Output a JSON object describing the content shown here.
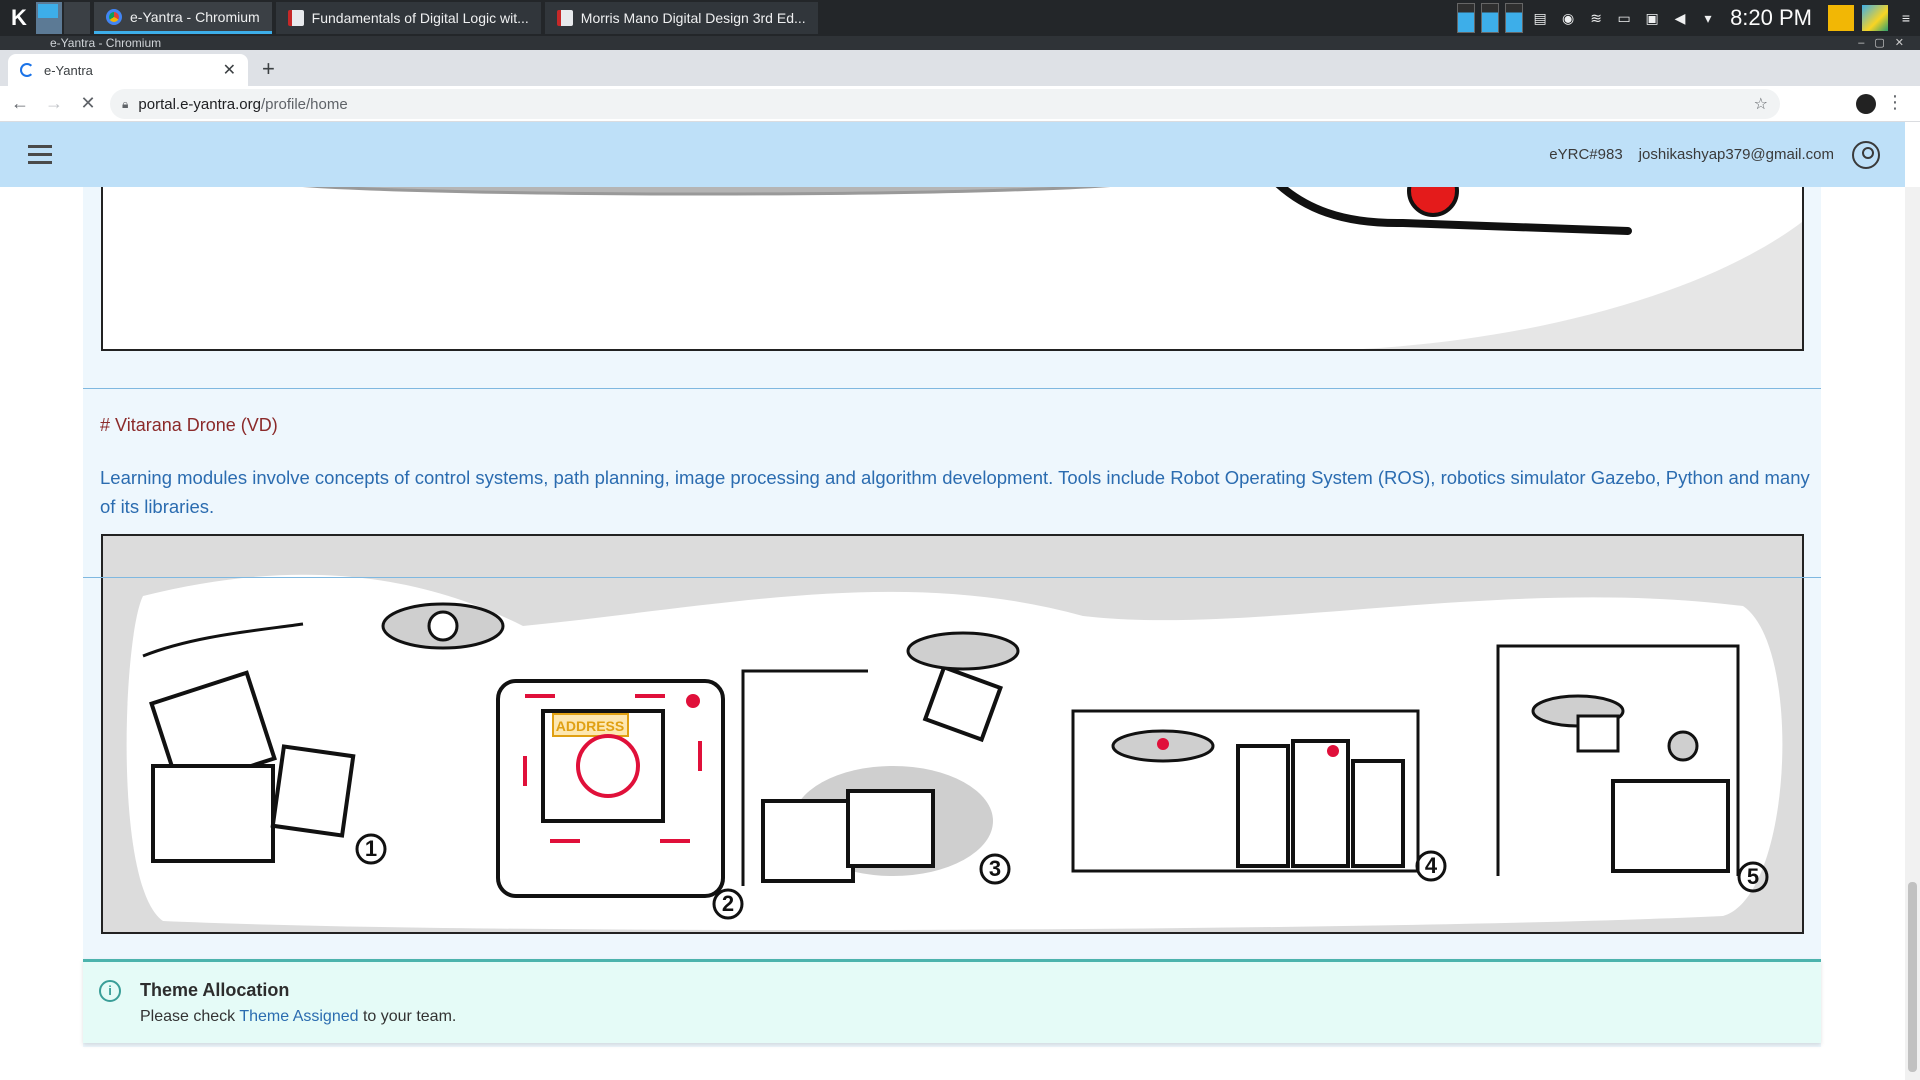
{
  "taskbar": {
    "tasks": [
      {
        "label": "e-Yantra - Chromium"
      },
      {
        "label": "Fundamentals of Digital Logic wit..."
      },
      {
        "label": "Morris Mano Digital Design 3rd Ed..."
      }
    ],
    "clock": "8:20 PM"
  },
  "window": {
    "title": "e-Yantra - Chromium"
  },
  "browser": {
    "tab_title": "e-Yantra",
    "url_host": "portal.e-yantra.org",
    "url_path": "/profile/home"
  },
  "header": {
    "team_id": "eYRC#983",
    "email": "joshikashyap379@gmail.com"
  },
  "theme_section": {
    "title": "# Vitarana Drone (VD)",
    "description": "Learning modules involve concepts of control systems, path planning, image processing and algorithm development. Tools include Robot Operating System (ROS), robotics simulator Gazebo, Python and many of its libraries.",
    "illustration_labels": [
      "ADDRESS",
      "1",
      "2",
      "3",
      "4",
      "5"
    ]
  },
  "alert": {
    "title": "Theme Allocation",
    "body_prefix": "Please check ",
    "link": "Theme Assigned",
    "body_suffix": " to your team."
  }
}
